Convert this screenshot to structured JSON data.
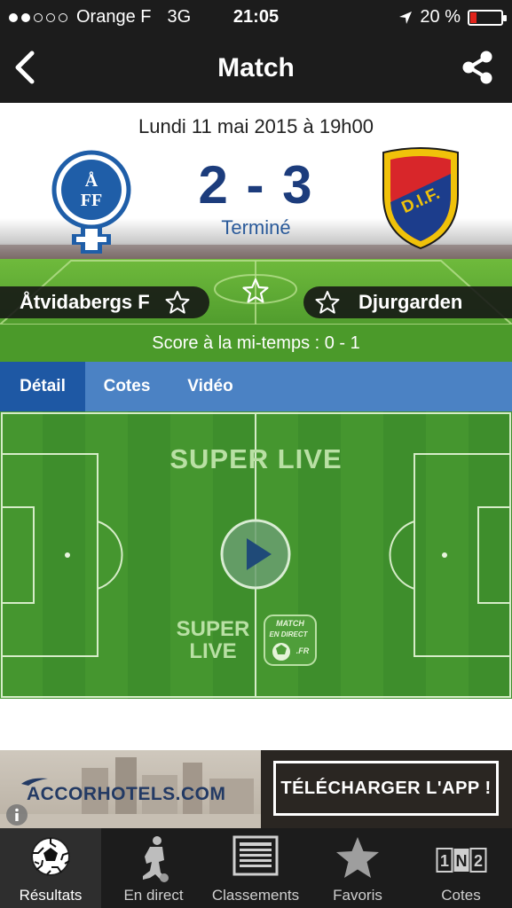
{
  "status_bar": {
    "carrier": "Orange F",
    "network": "3G",
    "time": "21:05",
    "battery": "20 %",
    "battery_level": 0.2,
    "signal_bars": 2
  },
  "nav": {
    "title": "Match",
    "back_icon": "chevron-left-icon",
    "share_icon": "share-icon"
  },
  "match": {
    "date": "Lundi 11 mai 2015 à 19h00",
    "score": "2 - 3",
    "status": "Terminé",
    "home_team": "Åtvidabergs F",
    "away_team": "Djurgarden",
    "home_crest_text": "ÅFF",
    "away_crest_text": "D.I.F.",
    "halftime": "Score à la mi-temps : 0 - 1"
  },
  "tabs": [
    {
      "label": "Détail",
      "active": true
    },
    {
      "label": "Cotes",
      "active": false
    },
    {
      "label": "Vidéo",
      "active": false
    }
  ],
  "player": {
    "title": "SUPER LIVE",
    "brand_line1": "SUPER",
    "brand_line2": "LIVE",
    "logo_text": "MATCH EN DIRECT .FR"
  },
  "ad": {
    "brand": "ACCORHOTELS.COM",
    "cta": "TÉLÉCHARGER L'APP !"
  },
  "tabbar": [
    {
      "label": "Résultats",
      "icon": "soccer-ball-icon",
      "active": true
    },
    {
      "label": "En direct",
      "icon": "player-icon",
      "active": false
    },
    {
      "label": "Classements",
      "icon": "standings-icon",
      "active": false
    },
    {
      "label": "Favoris",
      "icon": "star-icon",
      "active": false
    },
    {
      "label": "Cotes",
      "icon": "odds-1n2-icon",
      "active": false
    }
  ],
  "colors": {
    "bar_dark": "#1c1c1c",
    "score_blue": "#1c3c7c",
    "tab_blue": "#4b82c4",
    "tab_active": "#1e58a4",
    "pitch_green": "#3e8e2c"
  }
}
